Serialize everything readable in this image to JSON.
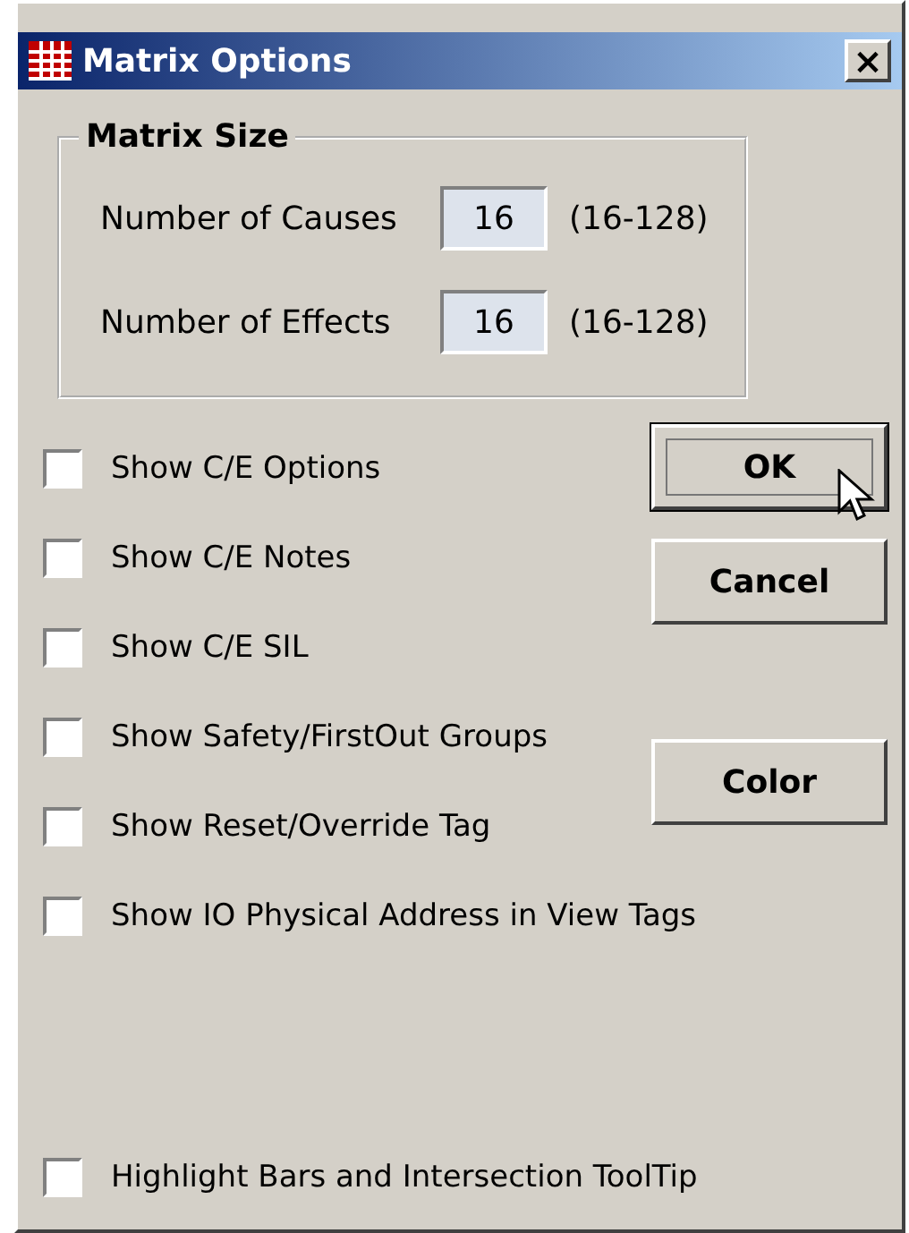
{
  "window": {
    "title": "Matrix Options",
    "close": "×"
  },
  "matrix_size": {
    "title": "Matrix Size",
    "fields": [
      {
        "label": "Number of Causes",
        "value": "16",
        "range": "(16-128)"
      },
      {
        "label": "Number of Effects",
        "value": "16",
        "range": "(16-128)"
      }
    ]
  },
  "options": [
    {
      "label": "Show C/E Options",
      "checked": false
    },
    {
      "label": "Show C/E Notes",
      "checked": false
    },
    {
      "label": "Show C/E SIL",
      "checked": false
    },
    {
      "label": "Show Safety/FirstOut Groups",
      "checked": false
    },
    {
      "label": "Show Reset/Override Tag",
      "checked": false
    },
    {
      "label": "Show IO Physical Address in View Tags",
      "checked": false
    }
  ],
  "buttons": [
    {
      "label": "OK",
      "focused": true
    },
    {
      "label": "Cancel",
      "focused": false
    },
    {
      "label": "Color",
      "focused": false
    }
  ],
  "bottom_option": {
    "label": "Highlight Bars and Intersection ToolTip",
    "checked": false
  }
}
